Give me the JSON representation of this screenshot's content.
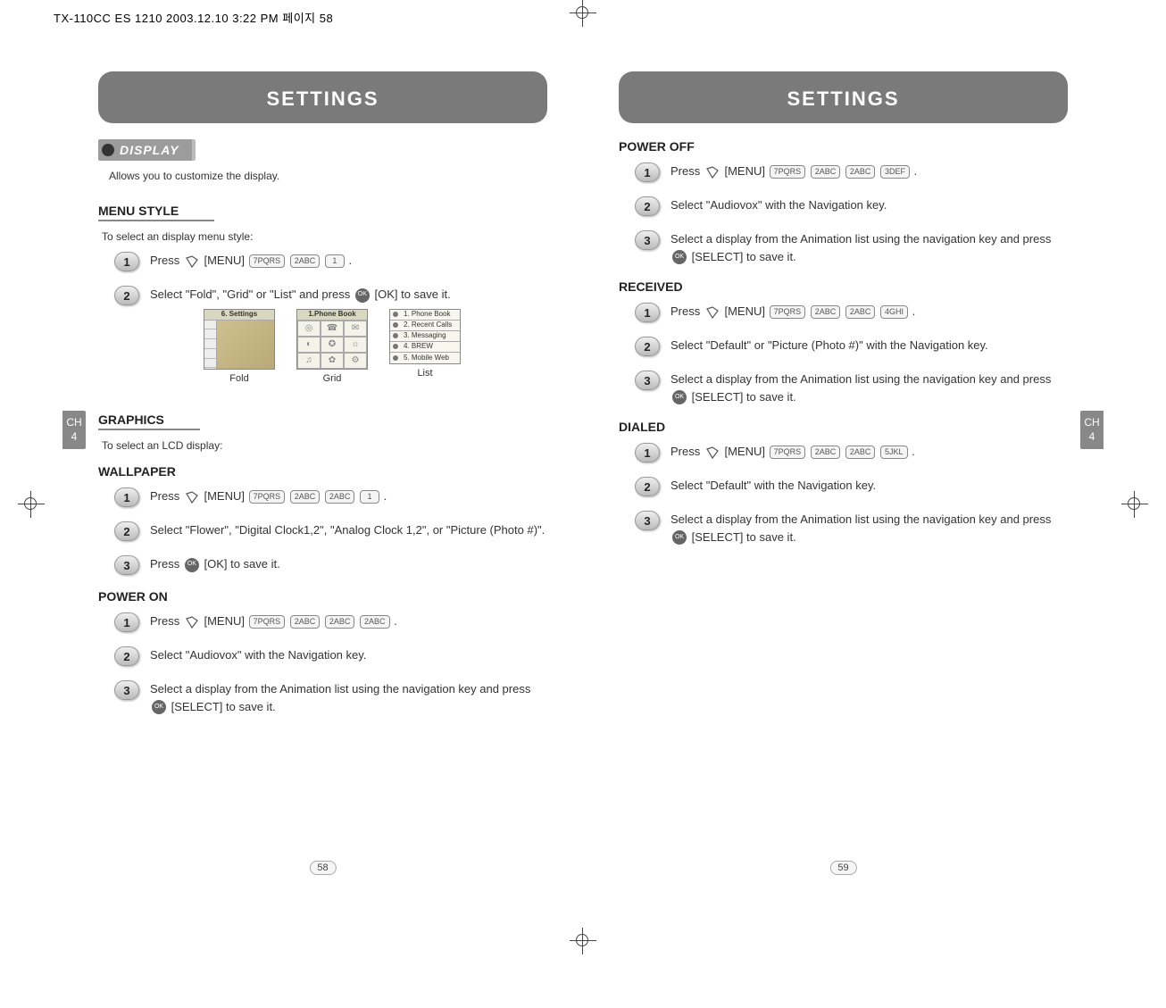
{
  "headerStrip": "TX-110CC ES 1210  2003.12.10 3:22 PM  페이지 58",
  "pageHeaders": {
    "left": "SETTINGS",
    "right": "SETTINGS"
  },
  "chapterTab": {
    "line1": "CH",
    "line2": "4"
  },
  "pageNumbers": {
    "left": "58",
    "right": "59"
  },
  "left": {
    "displayPill": "DISPLAY",
    "displayDesc": "Allows you to customize the display.",
    "menuStyle": {
      "heading": "MENU STYLE",
      "desc": "To select an display menu style:",
      "step1_a": "Press ",
      "step1_b": " [MENU] ",
      "step1_keys": [
        "7PQRS",
        "2ABC",
        "1"
      ],
      "step1_c": ".",
      "step2_a": "Select \"Fold\", \"Grid\" or \"List\" and press ",
      "step2_b": " [OK] to save it.",
      "screens": {
        "foldLabel": "Fold",
        "gridHeader": "1.Phone Book",
        "gridLabel": "Grid",
        "listItems": [
          "1. Phone Book",
          "2. Recent Calls",
          "3. Messaging",
          "4. BREW",
          "5. Mobile Web"
        ],
        "listLabel": "List",
        "foldHeader": "6. Settings"
      }
    },
    "graphics": {
      "heading": "GRAPHICS",
      "desc": "To select an LCD display:"
    },
    "wallpaper": {
      "heading": "WALLPAPER",
      "step1_a": "Press ",
      "step1_b": " [MENU] ",
      "step1_keys": [
        "7PQRS",
        "2ABC",
        "2ABC",
        "1"
      ],
      "step1_c": ".",
      "step2": "Select \"Flower\", \"Digital Clock1,2\", \"Analog Clock 1,2\", or \"Picture (Photo #)\".",
      "step3_a": "Press ",
      "step3_b": " [OK] to save it."
    },
    "powerOn": {
      "heading": "POWER ON",
      "step1_a": "Press ",
      "step1_b": " [MENU] ",
      "step1_keys": [
        "7PQRS",
        "2ABC",
        "2ABC",
        "2ABC"
      ],
      "step1_c": ".",
      "step2": "Select \"Audiovox\" with the Navigation key.",
      "step3_a": "Select a display from the Animation list using the navigation key and press ",
      "step3_b": " [SELECT] to save it."
    }
  },
  "right": {
    "powerOff": {
      "heading": "POWER OFF",
      "step1_a": "Press ",
      "step1_b": " [MENU] ",
      "step1_keys": [
        "7PQRS",
        "2ABC",
        "2ABC",
        "3DEF"
      ],
      "step1_c": ".",
      "step2": "Select \"Audiovox\" with the Navigation key.",
      "step3_a": "Select a display from the Animation list using the navigation key and press ",
      "step3_b": " [SELECT] to save it."
    },
    "received": {
      "heading": "RECEIVED",
      "step1_a": "Press ",
      "step1_b": " [MENU] ",
      "step1_keys": [
        "7PQRS",
        "2ABC",
        "2ABC",
        "4GHI"
      ],
      "step1_c": ".",
      "step2": "Select \"Default\" or \"Picture (Photo #)\" with the Navigation key.",
      "step3_a": "Select a display from the Animation list using the navigation key and press ",
      "step3_b": " [SELECT] to save it."
    },
    "dialed": {
      "heading": "DIALED",
      "step1_a": "Press ",
      "step1_b": " [MENU] ",
      "step1_keys": [
        "7PQRS",
        "2ABC",
        "2ABC",
        "5JKL"
      ],
      "step1_c": ".",
      "step2": "Select \"Default\" with the Navigation key.",
      "step3_a": "Select a display from the Animation list using the navigation key and press ",
      "step3_b": " [SELECT] to save it."
    }
  }
}
